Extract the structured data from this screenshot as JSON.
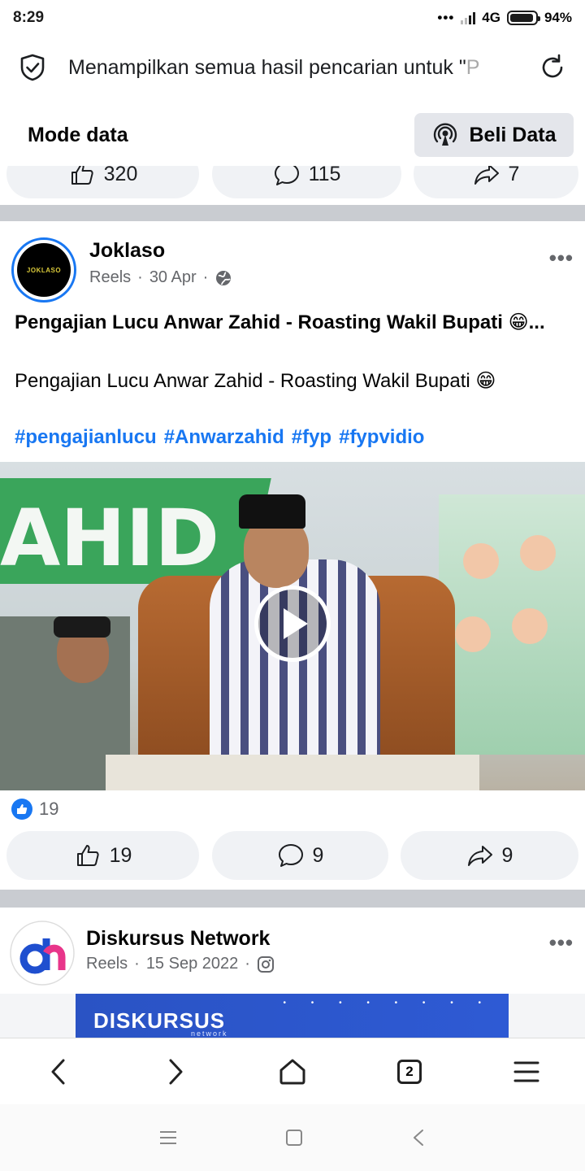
{
  "status_bar": {
    "time": "8:29",
    "network": "4G",
    "battery": "94%",
    "battery_level": 0.94
  },
  "search": {
    "text": "Menampilkan semua hasil pencarian untuk \"",
    "text_fade": "P"
  },
  "mode": {
    "title": "Mode data",
    "buy_label": "Beli Data"
  },
  "prev_post": {
    "likes": "320",
    "comments": "115",
    "shares": "7"
  },
  "post1": {
    "author": "Joklaso",
    "avatar_text": "JOKLASO",
    "source": "Reels",
    "date": "30 Apr",
    "title": "Pengajian Lucu Anwar Zahid - Roasting Wakil Bupati 😁...",
    "body": "Pengajian Lucu Anwar Zahid - Roasting Wakil Bupati 😁",
    "hashtags": [
      "#pengajianlucu",
      "#Anwarzahid",
      "#fyp",
      "#fypvidio"
    ],
    "video_banner": "AHID",
    "reaction_count": "19",
    "likes": "19",
    "comments": "9",
    "shares": "9"
  },
  "post2": {
    "author": "Diskursus Network",
    "source": "Reels",
    "date": "15 Sep 2022",
    "banner_text": "DISKURSUS",
    "banner_sub": "network"
  },
  "browser_nav": {
    "tabs": "2"
  },
  "colors": {
    "accent": "#1877f2",
    "divider": "#c9ccd1",
    "pill": "#f0f2f5"
  }
}
